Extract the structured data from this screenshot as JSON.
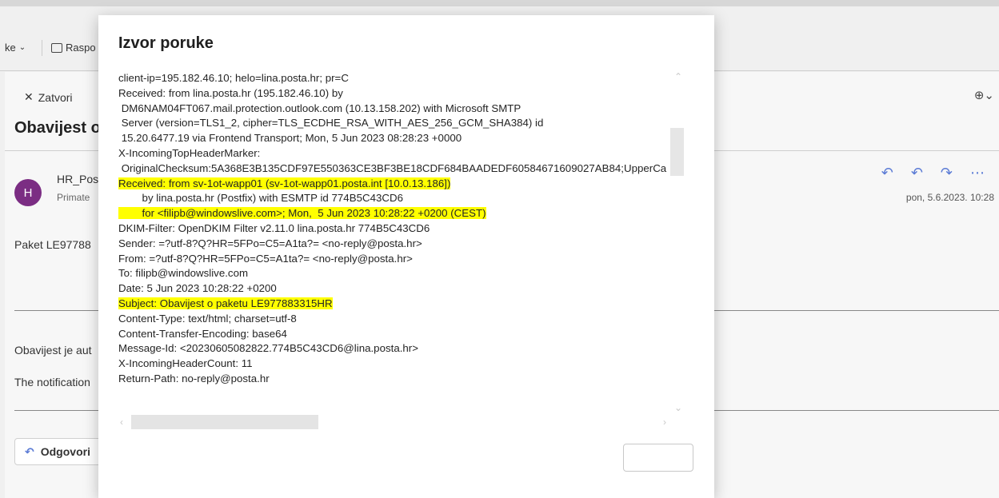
{
  "background": {
    "toolbar": {
      "item1_label": "ke",
      "item2_label": "Raspo"
    },
    "close_label": "Zatvori",
    "subject_label": "Obavijest o",
    "sender": {
      "avatar_letter": "H",
      "name": "HR_Pos",
      "to": "Primate"
    },
    "date": "pon, 5.6.2023. 10:28",
    "body_lines": [
      "Paket LE97788",
      "Obavijest je aut",
      "The notification"
    ],
    "reply_label": "Odgovori"
  },
  "modal": {
    "title": "Izvor poruke",
    "lines": [
      {
        "text": "client-ip=195.182.46.10; helo=lina.posta.hr; pr=C",
        "highlight": false
      },
      {
        "text": "Received: from lina.posta.hr (195.182.46.10) by",
        "highlight": false
      },
      {
        "text": " DM6NAM04FT067.mail.protection.outlook.com (10.13.158.202) with Microsoft SMTP",
        "highlight": false
      },
      {
        "text": " Server (version=TLS1_2, cipher=TLS_ECDHE_RSA_WITH_AES_256_GCM_SHA384) id",
        "highlight": false
      },
      {
        "text": " 15.20.6477.19 via Frontend Transport; Mon, 5 Jun 2023 08:28:23 +0000",
        "highlight": false
      },
      {
        "text": "X-IncomingTopHeaderMarker:",
        "highlight": false
      },
      {
        "text": " OriginalChecksum:5A368E3B135CDF97E550363CE3BF3BE18CDF684BAADEDF60584671609027AB84;UpperCa",
        "highlight": false
      },
      {
        "text": "Received: from sv-1ot-wapp01 (sv-1ot-wapp01.posta.int [10.0.13.186])",
        "highlight": true
      },
      {
        "text": "        by lina.posta.hr (Postfix) with ESMTP id 774B5C43CD6",
        "highlight": false
      },
      {
        "text": "        for <filipb@windowslive.com>; Mon,  5 Jun 2023 10:28:22 +0200 (CEST)",
        "highlight": true
      },
      {
        "text": "DKIM-Filter: OpenDKIM Filter v2.11.0 lina.posta.hr 774B5C43CD6",
        "highlight": false
      },
      {
        "text": "Sender: =?utf-8?Q?HR=5FPo=C5=A1ta?= <no-reply@posta.hr>",
        "highlight": false
      },
      {
        "text": "From: =?utf-8?Q?HR=5FPo=C5=A1ta?= <no-reply@posta.hr>",
        "highlight": false
      },
      {
        "text": "To: filipb@windowslive.com",
        "highlight": false
      },
      {
        "text": "Date: 5 Jun 2023 10:28:22 +0200",
        "highlight": false
      },
      {
        "text": "Subject: Obavijest o paketu LE977883315HR",
        "highlight": true
      },
      {
        "text": "Content-Type: text/html; charset=utf-8",
        "highlight": false
      },
      {
        "text": "Content-Transfer-Encoding: base64",
        "highlight": false
      },
      {
        "text": "Message-Id: <20230605082822.774B5C43CD6@lina.posta.hr>",
        "highlight": false
      },
      {
        "text": "X-IncomingHeaderCount: 11",
        "highlight": false
      },
      {
        "text": "Return-Path: no-reply@posta.hr",
        "highlight": false
      }
    ],
    "highlight_color": "#ffff00"
  }
}
